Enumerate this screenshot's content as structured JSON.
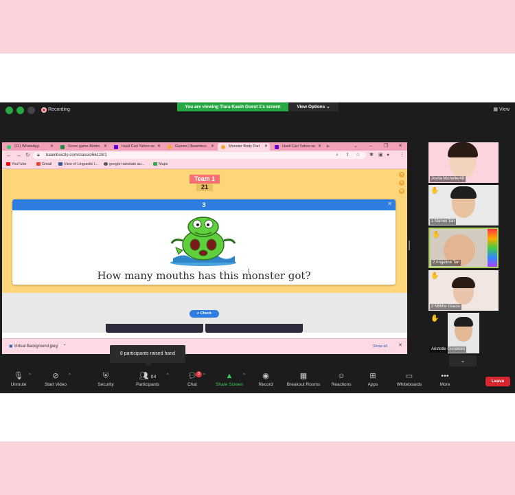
{
  "zoom": {
    "recording_label": "Recording",
    "viewing_banner": "You are viewing Tiara Kasih Guest 1's screen",
    "view_options_label": "View Options ⌄",
    "view_label": "View"
  },
  "browser": {
    "tabs": [
      {
        "label": "(11) WhatsApp",
        "icon_color": "#25d366"
      },
      {
        "label": "Score game Abdim",
        "icon_color": "#1e8e3e"
      },
      {
        "label": "Hasil Cari Yahoo se",
        "icon_color": "#6001d2"
      },
      {
        "label": "Games | Baamboo",
        "icon_color": "#f4a72f"
      },
      {
        "label": "Monster Body Part",
        "icon_color": "#f4a72f"
      },
      {
        "label": "Hasil Cari Yahoo se",
        "icon_color": "#6001d2"
      }
    ],
    "url": "baamboozle.com/classic/66128/1",
    "bookmarks": [
      {
        "label": "YouTube",
        "icon_color": "#ff0000"
      },
      {
        "label": "Gmail",
        "icon_color": "#ea4335"
      },
      {
        "label": "View of Linguistic I...",
        "icon_color": "#3b5998"
      },
      {
        "label": "google translate au...",
        "icon_color": "#555555"
      },
      {
        "label": "Maps",
        "icon_color": "#34a853"
      }
    ],
    "downloads": {
      "file": "Virtual Background.jpeg",
      "show_all": "Show all"
    }
  },
  "game": {
    "team_label": "Team 1",
    "team_score": "21",
    "question_number": "3",
    "question": "How many mouths has this monster got?",
    "check_label": "Check"
  },
  "participants": [
    {
      "name": "Jovita Michelle/4B",
      "hand": false
    },
    {
      "name": "1 Marvel Tan",
      "hand": true
    },
    {
      "name": "2 Angeline Tan",
      "hand": true
    },
    {
      "name": "2 Milkha Gracia",
      "hand": true
    },
    {
      "name": "Aristotle Gunawan",
      "hand": true
    }
  ],
  "toolbar": {
    "unmute": "Unmute",
    "start_video": "Start Video",
    "security": "Security",
    "participants": "Participants",
    "participants_count": "64",
    "chat": "Chat",
    "chat_badge": "3",
    "share_screen": "Share Screen",
    "record": "Record",
    "breakout_rooms": "Breakout Rooms",
    "reactions": "Reactions",
    "apps": "Apps",
    "whiteboards": "Whiteboards",
    "more": "More",
    "leave": "Leave"
  },
  "tooltip": "8 participants raised hand",
  "colors": {
    "border_pink": "#fbd3dc",
    "zoom_bg": "#1c1c1c",
    "share_green": "#27a844",
    "leave_red": "#d7262f",
    "game_yellow": "#fdd67a",
    "team_red": "#f6716f",
    "card_blue": "#2f7de1"
  }
}
